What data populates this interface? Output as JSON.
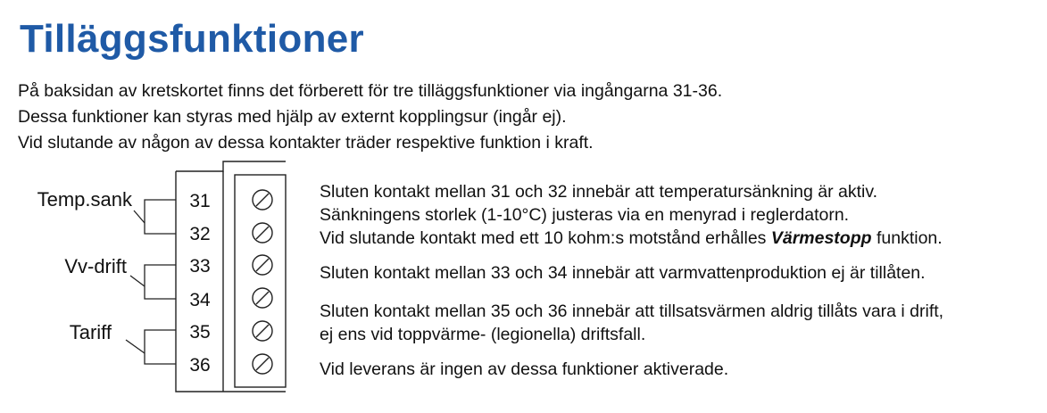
{
  "title": "Tilläggsfunktioner",
  "intro": [
    "På baksidan av kretskortet finns det förberett för tre tilläggsfunktioner via ingångarna 31-36.",
    "Dessa funktioner kan styras med hjälp av externt kopplingsur (ingår ej).",
    "Vid slutande av någon av dessa kontakter träder respektive funktion i kraft."
  ],
  "diagram": {
    "groups": [
      "Temp.sank",
      "Vv-drift",
      "Tariff"
    ],
    "terminals": [
      "31",
      "32",
      "33",
      "34",
      "35",
      "36"
    ]
  },
  "descriptions": {
    "d1_line1": "Sluten kontakt mellan 31 och 32 innebär att temperatursänkning är aktiv.",
    "d1_line2": "Sänkningens storlek (1-10°C) justeras via en menyrad i reglerdatorn.",
    "d1_line3_pre": "Vid slutande kontakt med ett 10 kohm:s motstånd erhålles ",
    "d1_line3_em": "Värmestopp",
    "d1_line3_post": " funktion.",
    "d2_line1": "Sluten kontakt mellan 33 och 34 innebär att varmvattenproduktion ej är tillåten.",
    "d3_line1": "Sluten kontakt mellan 35 och 36 innebär att tillsatsvärmen aldrig tillåts vara i drift,",
    "d3_line2": "ej ens vid toppvärme- (legionella) driftsfall.",
    "d4_line1": "Vid leverans är ingen av dessa funktioner aktiverade."
  }
}
